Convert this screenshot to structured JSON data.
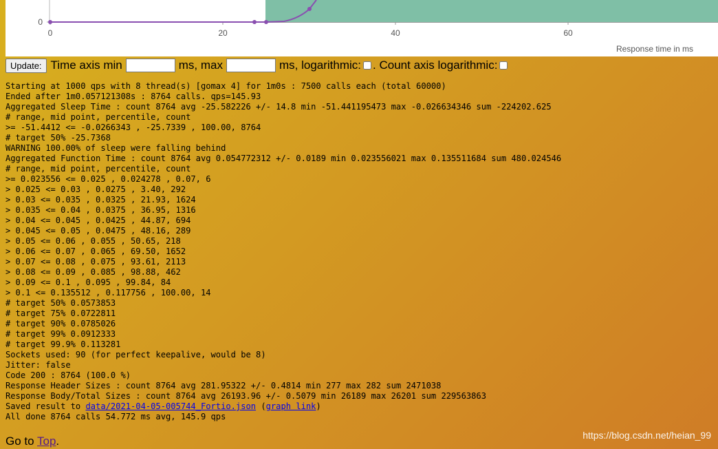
{
  "chart": {
    "y_tick": "0",
    "x_ticks": [
      "0",
      "20",
      "40",
      "60"
    ],
    "x_axis_title": "Response time in ms",
    "colors": {
      "bar_fill": "#7fbfa6",
      "line": "#8a4fb0"
    }
  },
  "controls": {
    "update_label": "Update:",
    "time_axis_min_label": "Time axis min",
    "ms_max_label": "ms, max",
    "ms_log_label": "ms, logarithmic:",
    "count_axis_label": ". Count axis logarithmic:",
    "time_min_value": "",
    "time_max_value": ""
  },
  "log": {
    "lines": [
      "Starting at 1000 qps with 8 thread(s) [gomax 4] for 1m0s : 7500 calls each (total 60000)",
      "Ended after 1m0.057121308s : 8764 calls. qps=145.93",
      "Aggregated Sleep Time : count 8764 avg -25.582226 +/- 14.8 min -51.441195473 max -0.026634346 sum -224202.625",
      "# range, mid point, percentile, count",
      ">= -51.4412 <= -0.0266343 , -25.7339 , 100.00, 8764",
      "# target 50% -25.7368",
      "WARNING 100.00% of sleep were falling behind",
      "Aggregated Function Time : count 8764 avg 0.054772312 +/- 0.0189 min 0.023556021 max 0.135511684 sum 480.024546",
      "# range, mid point, percentile, count",
      ">= 0.023556 <= 0.025 , 0.024278 , 0.07, 6",
      "> 0.025 <= 0.03 , 0.0275 , 3.40, 292",
      "> 0.03 <= 0.035 , 0.0325 , 21.93, 1624",
      "> 0.035 <= 0.04 , 0.0375 , 36.95, 1316",
      "> 0.04 <= 0.045 , 0.0425 , 44.87, 694",
      "> 0.045 <= 0.05 , 0.0475 , 48.16, 289",
      "> 0.05 <= 0.06 , 0.055 , 50.65, 218",
      "> 0.06 <= 0.07 , 0.065 , 69.50, 1652",
      "> 0.07 <= 0.08 , 0.075 , 93.61, 2113",
      "> 0.08 <= 0.09 , 0.085 , 98.88, 462",
      "> 0.09 <= 0.1 , 0.095 , 99.84, 84",
      "> 0.1 <= 0.135512 , 0.117756 , 100.00, 14",
      "# target 50% 0.0573853",
      "# target 75% 0.0722811",
      "# target 90% 0.0785026",
      "# target 99% 0.0912333",
      "# target 99.9% 0.113281",
      "Sockets used: 90 (for perfect keepalive, would be 8)",
      "Jitter: false",
      "Code 200 : 8764 (100.0 %)",
      "Response Header Sizes : count 8764 avg 281.95322 +/- 0.4814 min 277 max 282 sum 2471038",
      "Response Body/Total Sizes : count 8764 avg 26193.96 +/- 0.5079 min 26189 max 26201 sum 229563863"
    ],
    "saved_prefix": "Saved result to ",
    "saved_link": "data/2021-04-05-005744_Fortio.json",
    "saved_middle": " (",
    "graph_link": "graph link",
    "saved_suffix": ")",
    "final_line": "All done 8764 calls 54.772 ms avg, 145.9 qps"
  },
  "footer": {
    "prefix": "Go to ",
    "link": "Top",
    "suffix": "."
  },
  "watermark": "https://blog.csdn.net/heian_99"
}
